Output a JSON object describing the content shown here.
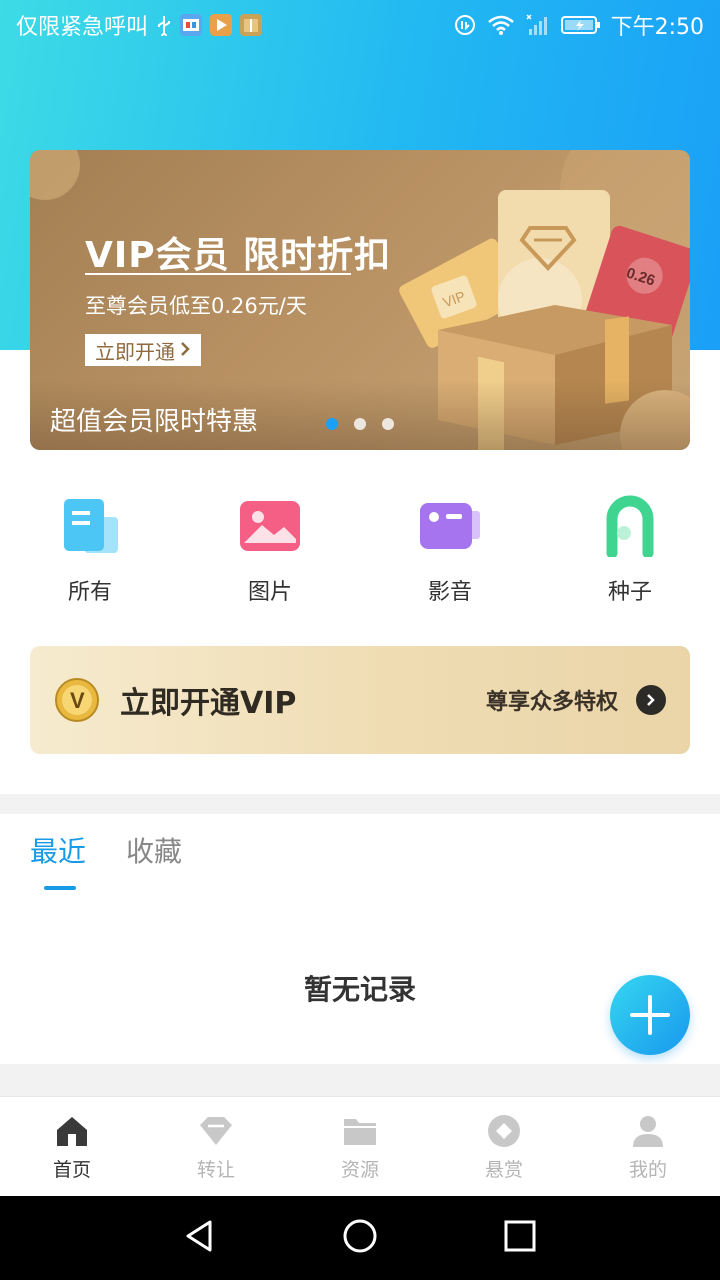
{
  "status_bar": {
    "carrier_text": "仅限紧急呼叫",
    "time": "下午2:50"
  },
  "banner": {
    "title": "VIP会员 限时折扣",
    "subtitle": "至尊会员低至0.26元/天",
    "button_label": "立即开通",
    "caption": "超值会员限时特惠",
    "ticket_text": "VIP",
    "coupon_text": "0.26",
    "dots_total": 3,
    "dots_active": 1
  },
  "quick_actions": [
    {
      "label": "所有",
      "icon": "document-icon"
    },
    {
      "label": "图片",
      "icon": "image-icon"
    },
    {
      "label": "影音",
      "icon": "video-icon"
    },
    {
      "label": "种子",
      "icon": "seed-icon"
    }
  ],
  "vip_card": {
    "badge": "V",
    "title": "立即开通VIP",
    "subtitle": "尊享众多特权"
  },
  "tabs": [
    {
      "label": "最近",
      "active": true
    },
    {
      "label": "收藏",
      "active": false
    }
  ],
  "empty_state": "暂无记录",
  "bottom_nav": [
    {
      "label": "首页",
      "icon": "home-icon",
      "active": true
    },
    {
      "label": "转让",
      "icon": "diamond-icon",
      "active": false
    },
    {
      "label": "资源",
      "icon": "folder-icon",
      "active": false
    },
    {
      "label": "悬赏",
      "icon": "reward-icon",
      "active": false
    },
    {
      "label": "我的",
      "icon": "user-icon",
      "active": false
    }
  ],
  "colors": {
    "accent": "#1a9be8",
    "header_gradient_start": "#3ddbe6",
    "header_gradient_end": "#1aa0f7",
    "banner_gold": "#b89163",
    "vip_card_bg": "#efdcb3"
  }
}
